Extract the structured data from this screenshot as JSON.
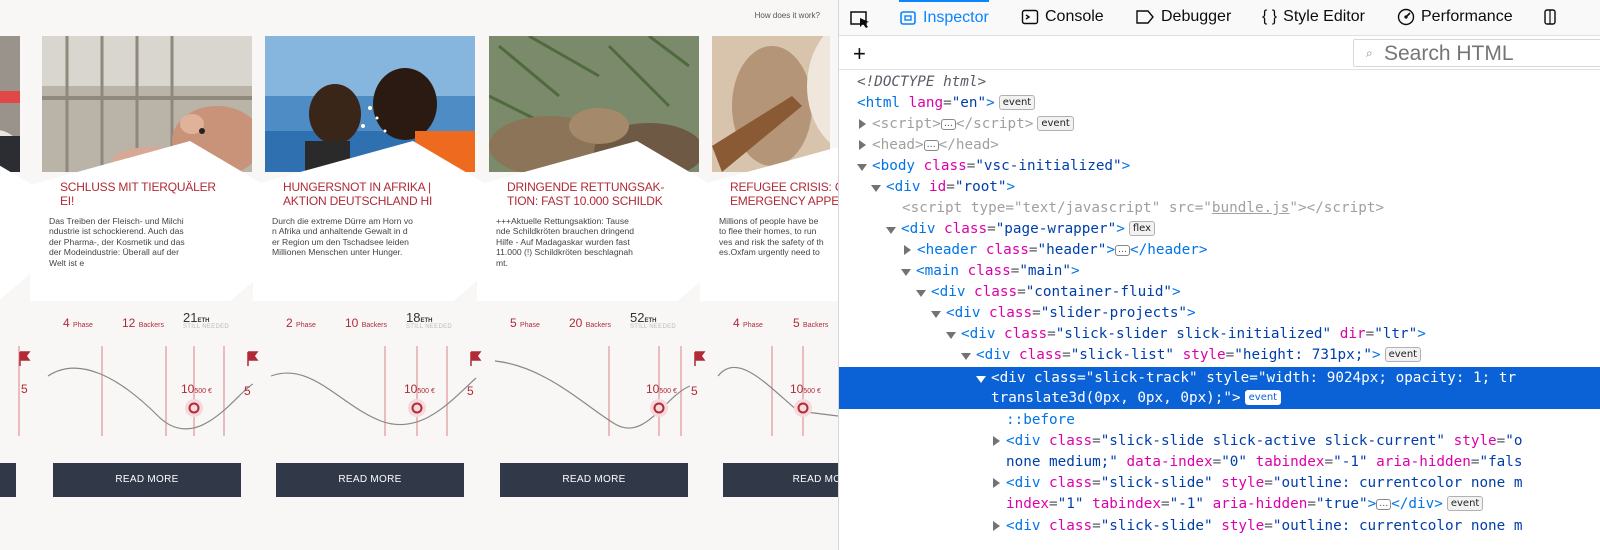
{
  "site": {
    "how_link": "How does it work?",
    "cards": [
      {
        "title": "SCHLUSS MIT TIERQUÄLER\nEI!",
        "desc": "Das Treiben der Fleisch- und Milchi\nndustrie ist schockierend. Auch das\nder Pharma-, der Kosmetik und das\nder Modeindustrie: Überall auf der\nWelt ist e",
        "phase": "4",
        "phase_label": "Phase",
        "backers": "12",
        "backers_label": "Backers",
        "eth": "21",
        "eth_unit": "ETH",
        "needed": "STILL NEEDED",
        "goal": "10",
        "goal_unit": "500 €",
        "milestone": "5",
        "button": "READ MORE"
      },
      {
        "title": "HUNGERSNOT IN AFRIKA |\nAKTION DEUTSCHLAND HI",
        "desc": "Durch die extreme Dürre am Horn vo\nn Afrika und anhaltende Gewalt in d\ner Region um den Tschadsee leiden\nMillionen Menschen unter Hunger.",
        "phase": "2",
        "phase_label": "Phase",
        "backers": "10",
        "backers_label": "Backers",
        "eth": "18",
        "eth_unit": "ETH",
        "needed": "STILL NEEDED",
        "goal": "10",
        "goal_unit": "500 €",
        "milestone": "5",
        "button": "READ MORE"
      },
      {
        "title": "DRINGENDE RETTUNGSAK-\nTION: FAST 10.000 SCHILDK",
        "desc": "+++Aktuelle Rettungsaktion: Tause\nnde Schildkröten brauchen dringend\nHilfe - Auf Madagaskar wurden fast\n11.000 (!) Schildkröten beschlagnah\nmt.",
        "phase": "5",
        "phase_label": "Phase",
        "backers": "20",
        "backers_label": "Backers",
        "eth": "52",
        "eth_unit": "ETH",
        "needed": "STILL NEEDED",
        "goal": "10",
        "goal_unit": "500 €",
        "milestone": "5",
        "button": "READ MORE"
      },
      {
        "title": "REFUGEE CRISIS: OX\nEMERGENCY APPEA",
        "desc": "Millions of people have be\nto flee their homes, to run\nves and risk the safety of th\nes.Oxfam urgently need to",
        "phase": "4",
        "phase_label": "Phase",
        "backers": "5",
        "backers_label": "Backers",
        "eth": "",
        "eth_unit": "",
        "needed": "",
        "goal": "10",
        "goal_unit": "500 €",
        "milestone": "",
        "button": "READ MO"
      }
    ],
    "partial_left": {
      "milestone": "5",
      "button": ""
    }
  },
  "devtools": {
    "tabs": [
      "Inspector",
      "Console",
      "Debugger",
      "Style Editor",
      "Performance"
    ],
    "search_placeholder": "Search HTML",
    "add_node": "+",
    "badges": {
      "event": "event",
      "flex": "flex",
      "dots": "…"
    }
  }
}
